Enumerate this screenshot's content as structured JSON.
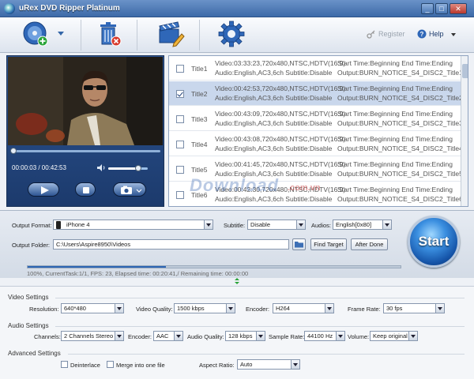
{
  "window": {
    "title": "uRex DVD Ripper Platinum",
    "minimize": "_",
    "maximize": "□",
    "close": "✕"
  },
  "toolbar": {
    "register": "Register",
    "help": "Help"
  },
  "player": {
    "time": "00:00:03 / 00:42:53",
    "seek_fraction": 0.0,
    "volume_fraction": 0.75
  },
  "titles": [
    {
      "name": "Title1",
      "checked": false,
      "video": "Video:03:33:23,720x480,NTSC,HDTV(16:9)",
      "audio": "Audio:English,AC3,6ch Subtitle:Disable",
      "start": "Start Time:Beginning End Time:Ending",
      "output": "Output:BURN_NOTICE_S4_DISC2_Title1"
    },
    {
      "name": "Title2",
      "checked": true,
      "video": "Video:00:42:53,720x480,NTSC,HDTV(16:9)",
      "audio": "Audio:English,AC3,6ch Subtitle:Disable",
      "start": "Start Time:Beginning End Time:Ending",
      "output": "Output:BURN_NOTICE_S4_DISC2_Title2"
    },
    {
      "name": "Title3",
      "checked": false,
      "video": "Video:00:43:09,720x480,NTSC,HDTV(16:9)",
      "audio": "Audio:English,AC3,6ch Subtitle:Disable",
      "start": "Start Time:Beginning End Time:Ending",
      "output": "Output:BURN_NOTICE_S4_DISC2_Title3"
    },
    {
      "name": "Title4",
      "checked": false,
      "video": "Video:00:43:08,720x480,NTSC,HDTV(16:9)",
      "audio": "Audio:English,AC3,6ch Subtitle:Disable",
      "start": "Start Time:Beginning End Time:Ending",
      "output": "Output:BURN_NOTICE_S4_DISC2_Title4"
    },
    {
      "name": "Title5",
      "checked": false,
      "video": "Video:00:41:45,720x480,NTSC,HDTV(16:9)",
      "audio": "Audio:English,AC3,6ch Subtitle:Disable",
      "start": "Start Time:Beginning End Time:Ending",
      "output": "Output:BURN_NOTICE_S4_DISC2_Title5"
    },
    {
      "name": "Title6",
      "checked": false,
      "video": "Video:00:42:30,720x480,NTSC,HDTV(16:9)",
      "audio": "Audio:English,AC3,6ch Subtitle:Disable",
      "start": "Start Time:Beginning End Time:Ending",
      "output": "Output:BURN_NOTICE_S4_DISC2_Title6"
    }
  ],
  "watermark": {
    "text": "Download",
    "suffix": ".com.vn"
  },
  "output": {
    "format_label": "Output Format:",
    "format_value": "iPhone 4",
    "subtitle_label": "Subtitle:",
    "subtitle_value": "Disable",
    "audios_label": "Audios:",
    "audios_value": "English[0x80]",
    "folder_label": "Output Folder:",
    "folder_value": "C:\\Users\\Aspire8950\\Videos",
    "open_target": "Find Target",
    "after_done": "After Done",
    "start": "Start",
    "progress_fraction": 0.37,
    "status": "100%, CurrentTask:1/1, FPS: 23, Elapsed time: 00:20:41,/ Remaining time: 00:00:00"
  },
  "settings": {
    "video": {
      "title": "Video Settings",
      "resolution_label": "Resolution:",
      "resolution": "640*480",
      "quality_label": "Video Quality:",
      "quality": "1500 kbps",
      "encoder_label": "Encoder:",
      "encoder": "H264",
      "framerate_label": "Frame Rate:",
      "framerate": "30 fps"
    },
    "audio": {
      "title": "Audio Settings",
      "channels_label": "Channels:",
      "channels": "2 Channels Stereo",
      "encoder_label": "Encoder:",
      "encoder": "AAC",
      "quality_label": "Audio Quality:",
      "quality": "128 kbps",
      "samplerate_label": "Sample Rate:",
      "samplerate": "44100 Hz",
      "volume_label": "Volume:",
      "volume": "Keep original"
    },
    "advanced": {
      "title": "Advanced Settings",
      "deinterlace": "Deinterlace",
      "merge": "Merge into one file",
      "aspect_label": "Aspect Ratio:",
      "aspect": "Auto"
    }
  },
  "colors": {
    "accent": "#2d66b3",
    "panel": "#1c3a6c",
    "selected_row": "#c9d7ec"
  }
}
